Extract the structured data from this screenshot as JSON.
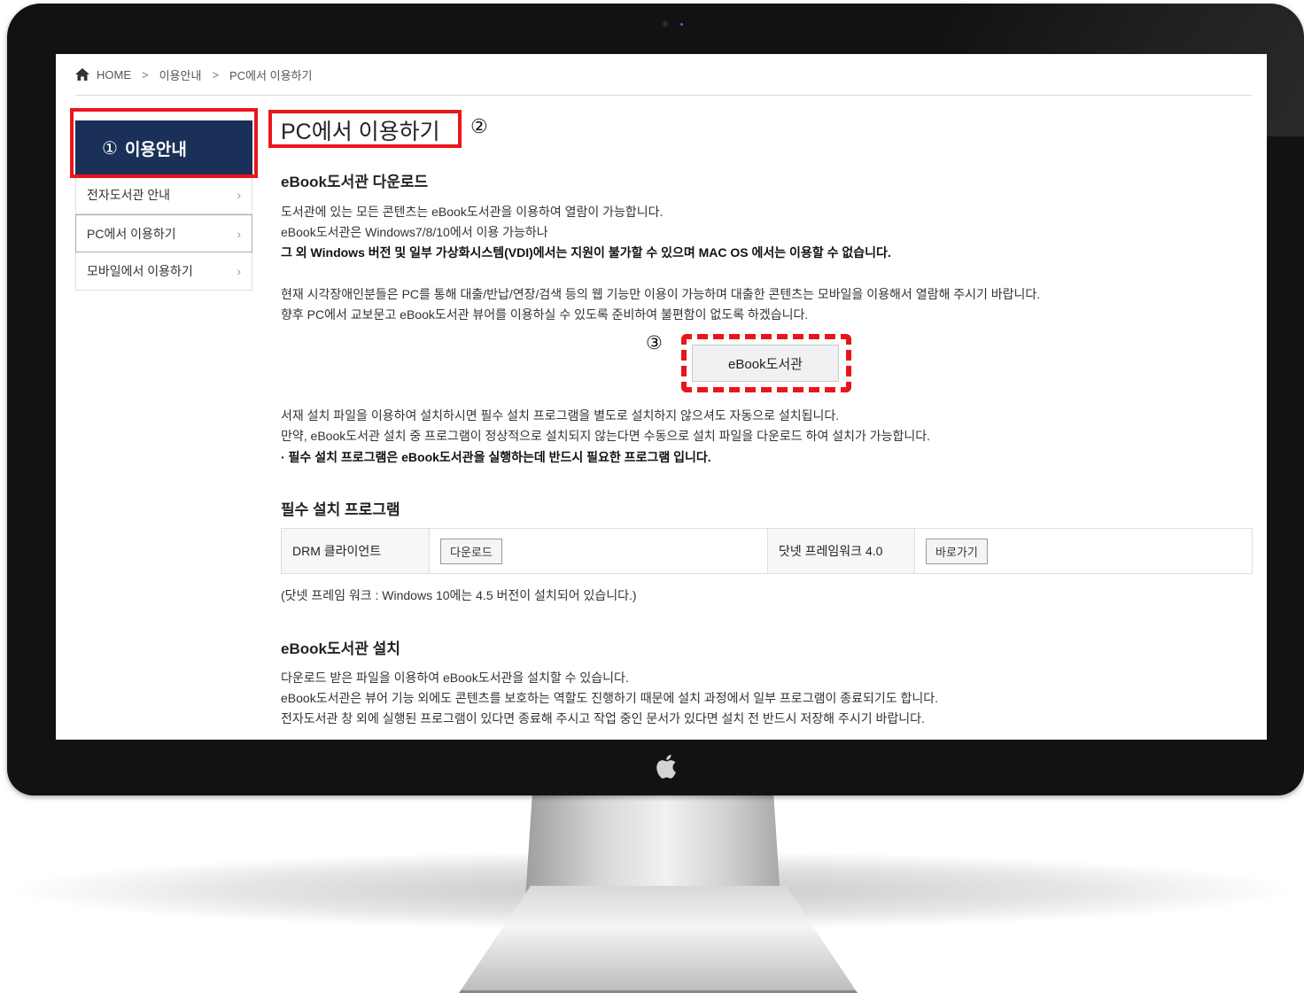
{
  "breadcrumb": {
    "home": "HOME",
    "separator": ">",
    "level1": "이용안내",
    "level2": "PC에서 이용하기"
  },
  "sidebar": {
    "heading_number": "①",
    "heading": "이용안내",
    "items": [
      {
        "label": "전자도서관 안내"
      },
      {
        "label": "PC에서 이용하기",
        "active": true
      },
      {
        "label": "모바일에서 이용하기"
      }
    ]
  },
  "main": {
    "title": "PC에서 이용하기",
    "title_marker": "②",
    "download_section": {
      "heading": "eBook도서관 다운로드",
      "lines": [
        "도서관에 있는 모든 콘텐츠는 eBook도서관을 이용하여 열람이 가능합니다.",
        "eBook도서관은 Windows7/8/10에서 이용 가능하나",
        "그 외 Windows 버전 및 일부 가상화시스템(VDI)에서는 지원이 불가할 수 있으며 MAC OS 에서는 이용할 수 없습니다."
      ],
      "notice_lines": [
        "현재 시각장애인분들은 PC를 통해 대출/반납/연장/검색 등의 웹 기능만 이용이 가능하며 대출한 콘텐츠는 모바일을 이용해서 열람해 주시기 바랍니다.",
        "향후 PC에서 교보문고 eBook도서관 뷰어를 이용하실 수 있도록 준비하여 불편함이 없도록 하겠습니다."
      ],
      "button_marker": "③",
      "button_label": "eBook도서관",
      "install_lines": [
        "서재 설치 파일을 이용하여 설치하시면 필수 설치 프로그램을 별도로 설치하지 않으셔도 자동으로 설치됩니다.",
        "만약, eBook도서관 설치 중 프로그램이 정상적으로 설치되지 않는다면 수동으로 설치 파일을 다운로드 하여 설치가 가능합니다.",
        "· 필수 설치 프로그램은 eBook도서관을 실행하는데 반드시 필요한 프로그램 입니다."
      ]
    },
    "required_section": {
      "heading": "필수 설치 프로그램",
      "programs": [
        {
          "name": "DRM 클라이언트",
          "button": "다운로드"
        },
        {
          "name": "닷넷 프레임워크 4.0",
          "button": "바로가기"
        }
      ],
      "note": "(닷넷 프레임 워크 : Windows 10에는 4.5 버전이 설치되어 있습니다.)"
    },
    "install_section": {
      "heading": "eBook도서관 설치",
      "lines": [
        "다운로드 받은 파일을 이용하여 eBook도서관을 설치할 수 있습니다.",
        "eBook도서관은 뷰어 기능 외에도 콘텐츠를 보호하는 역할도 진행하기 때문에 설치 과정에서 일부 프로그램이 종료되기도 합니다.",
        "전자도서관 창 외에 실행된 프로그램이 있다면 종료해 주시고 작업 중인 문서가 있다면 설치 전 반드시 저장해 주시기 바랍니다."
      ]
    }
  },
  "colors": {
    "sidebar_heading_bg": "#1a3058",
    "highlight_red": "#e8161b",
    "monitor_bezel": "#121212"
  },
  "icons": [
    "home-icon",
    "chevron-right-icon",
    "apple-logo-icon",
    "camera-icon"
  ]
}
